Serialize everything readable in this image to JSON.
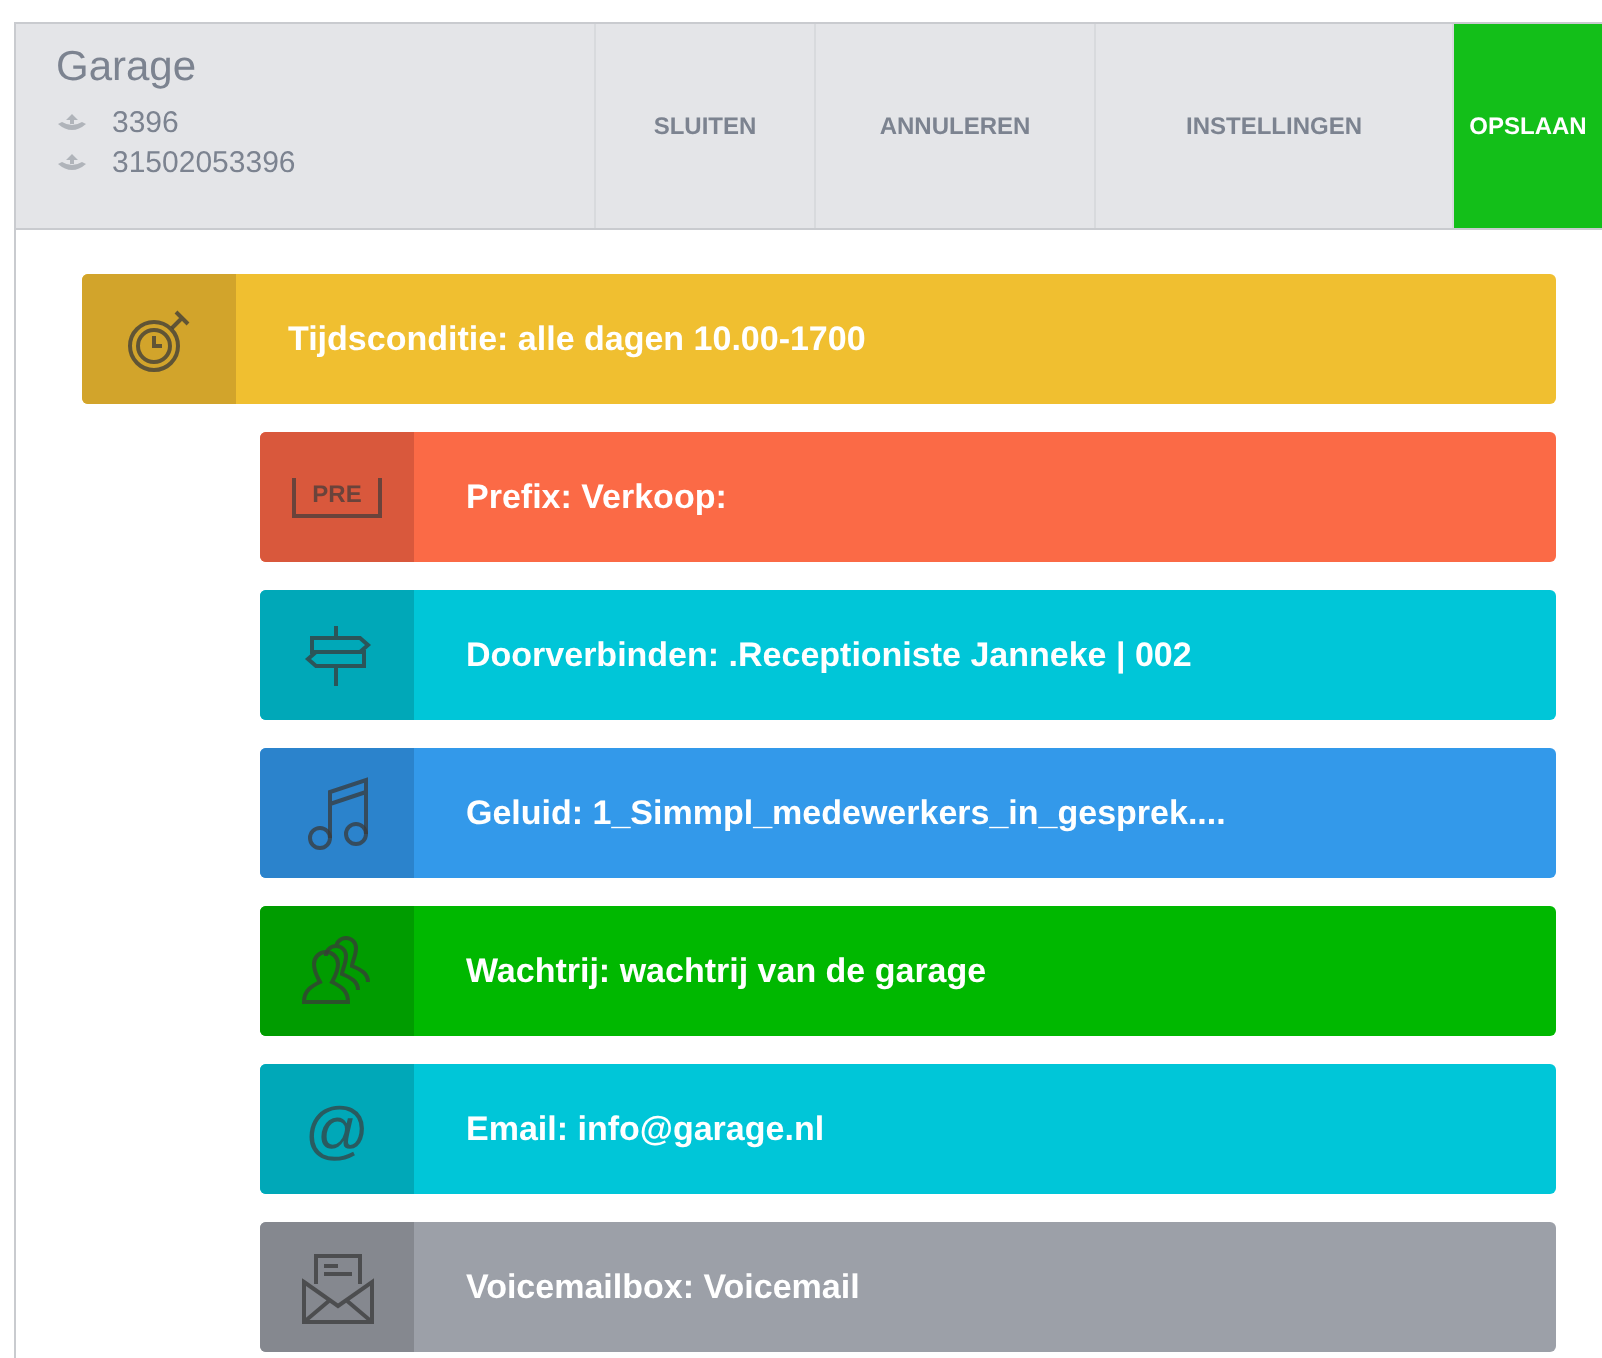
{
  "header": {
    "title": "Garage",
    "numbers": [
      "3396",
      "31502053396"
    ]
  },
  "buttons": [
    {
      "label": "SLUITEN",
      "primary": false
    },
    {
      "label": "ANNULEREN",
      "primary": false
    },
    {
      "label": "INSTELLINGEN",
      "primary": false
    },
    {
      "label": "OPSLAAN",
      "primary": true
    }
  ],
  "flow": [
    {
      "kind": "time",
      "text": "Tijdsconditie: alle dagen 10.00-1700",
      "children": [
        {
          "kind": "prefix",
          "icon_text": "PRE",
          "text": "Prefix: Verkoop:"
        },
        {
          "kind": "forward",
          "text": "Doorverbinden: .Receptioniste Janneke | 002"
        },
        {
          "kind": "sound",
          "text": "Geluid: 1_Simmpl_medewerkers_in_gesprek...."
        },
        {
          "kind": "queue",
          "text": "Wachtrij: wachtrij van de garage"
        },
        {
          "kind": "email",
          "icon_text": "@",
          "text": "Email: info@garage.nl"
        },
        {
          "kind": "voicemail",
          "text": "Voicemailbox: Voicemail"
        }
      ]
    }
  ]
}
